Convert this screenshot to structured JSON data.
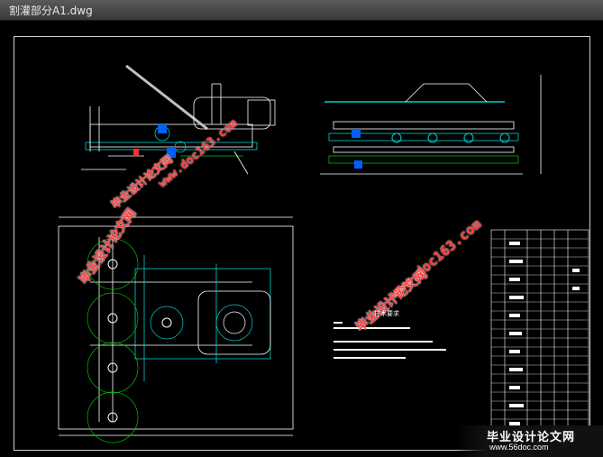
{
  "window": {
    "title": "割灌部分A1.dwg"
  },
  "watermarks": [
    {
      "text": "毕业设计论文网",
      "kind": "cn"
    },
    {
      "text": "www.doc163.com",
      "kind": "url"
    }
  ],
  "tech_requirements": {
    "heading": "技术要求",
    "lines": [
      "1.",
      "2.",
      "3."
    ]
  },
  "footer_logo": {
    "name": "毕业设计论文网",
    "url": "www.56doc.com"
  },
  "colors": {
    "background": "#000000",
    "line_cyan": "#00d0d0",
    "line_white": "#ffffff",
    "line_green": "#00c000",
    "watermark": "#ff3b3b"
  }
}
